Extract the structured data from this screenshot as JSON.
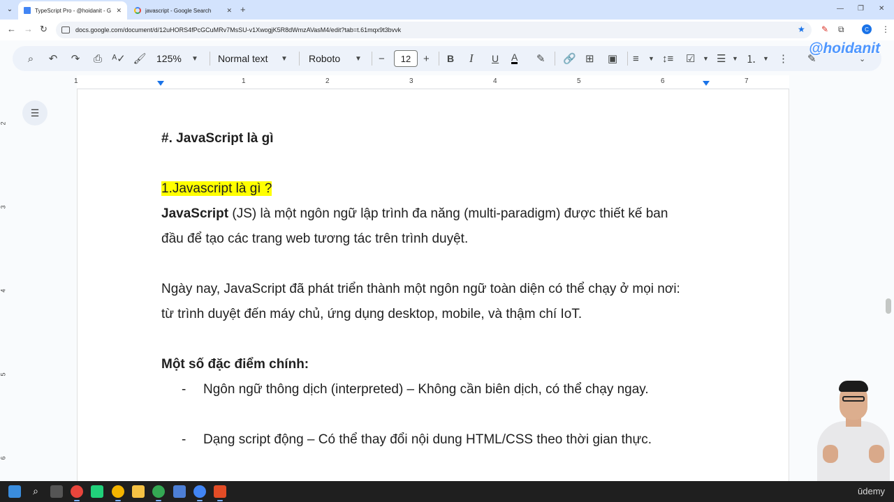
{
  "browser": {
    "tabs": [
      {
        "title": "TypeScript Pro - @hoidanit - G",
        "icon": "google-docs-icon",
        "active": true
      },
      {
        "title": "javascript - Google Search",
        "icon": "google-icon",
        "active": false
      }
    ],
    "url": "docs.google.com/document/d/12uHORS4fPcGCuMRv7MsSU-v1XwogjK5R8dWmzAVasM4/edit?tab=t.61mqx9t3bvvk",
    "profile_initial": "C"
  },
  "toolbar": {
    "zoom": "125%",
    "style": "Normal text",
    "font": "Roboto",
    "font_size": "12",
    "bold": "B",
    "italic": "I",
    "underline": "U",
    "text_color": "A"
  },
  "watermark": "@hoidanit",
  "ruler": {
    "labels": [
      "1",
      "1",
      "2",
      "3",
      "4",
      "5",
      "6",
      "7"
    ],
    "vertical_labels": [
      "2",
      "3",
      "4",
      "5",
      "6"
    ]
  },
  "document": {
    "heading": "#. JavaScript là gì",
    "section_title": "1.Javascript là gì ?",
    "p1_bold": "JavaScript",
    "p1_line1_rest": " (JS) là một ngôn ngữ lập trình đa năng (multi-paradigm) được thiết kế ban",
    "p1_line2": "đầu để tạo các trang web tương tác trên trình duyệt.",
    "p2_line1": "Ngày nay, JavaScript đã phát triển thành một ngôn ngữ toàn diện có thể chạy ở mọi nơi:",
    "p2_line2": "từ trình duyệt đến máy chủ, ứng dụng desktop, mobile, và thậm chí IoT.",
    "features_title": "Một số đặc điểm chính:",
    "bullets": [
      "Ngôn ngữ thông dịch (interpreted) – Không cần biên dịch, có thể chạy ngay.",
      "Dạng script động – Có thể thay đổi nội dung HTML/CSS theo thời gian thực."
    ],
    "bullet_marker": "-"
  },
  "overlay_brand": "ūdemy",
  "colors": {
    "highlight": "#ffff00",
    "accent": "#1a73e8",
    "tabstrip": "#d3e3fd"
  }
}
